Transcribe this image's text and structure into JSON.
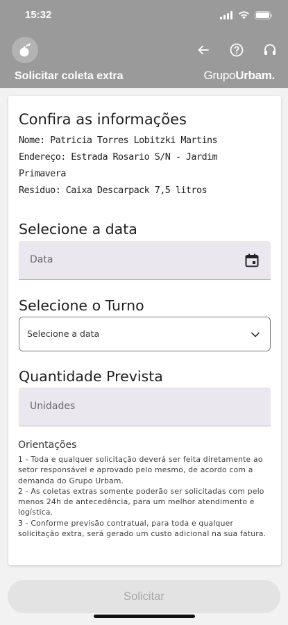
{
  "status_bar": {
    "time": "15:32"
  },
  "header": {
    "title": "Solicitar coleta extra",
    "brand_prefix": "Grupo",
    "brand_suffix": "Urbam.",
    "icons": [
      "back-arrow-icon",
      "help-icon",
      "headset-icon"
    ]
  },
  "confirm": {
    "title": "Confira as informações",
    "name": "Nome: Patricia Torres Lobitzki Martins",
    "address": "Endereço: Estrada Rosario S/N - Jardim Primavera",
    "residue": "Residuo: Caixa Descarpack 7,5 litros"
  },
  "date_section": {
    "title": "Selecione a data",
    "placeholder": "Data"
  },
  "shift_section": {
    "title": "Selecione o Turno",
    "select_value": "Selecione a data"
  },
  "quantity_section": {
    "title": "Quantidade Prevista",
    "placeholder": "Unidades"
  },
  "guidelines": {
    "title": "Orientações",
    "items": [
      "1 - Toda e qualquer solicitação deverá ser feita diretamente ao setor responsável e aprovado pelo mesmo, de acordo com a demanda do Grupo Urbam.",
      "2 - As coletas extras somente poderão ser solicitadas com pelo menos 24h de antecedência, para um melhor atendimento e logística.",
      "3 - Conforme previsão contratual, para toda e qualquer solicitação extra, será  gerado um custo adicional na sua fatura."
    ]
  },
  "submit_label": "Solicitar",
  "colors": {
    "header_bg": "#9a9a9a",
    "field_bg": "#ebe7ef",
    "button_bg": "#e3e3e3"
  }
}
